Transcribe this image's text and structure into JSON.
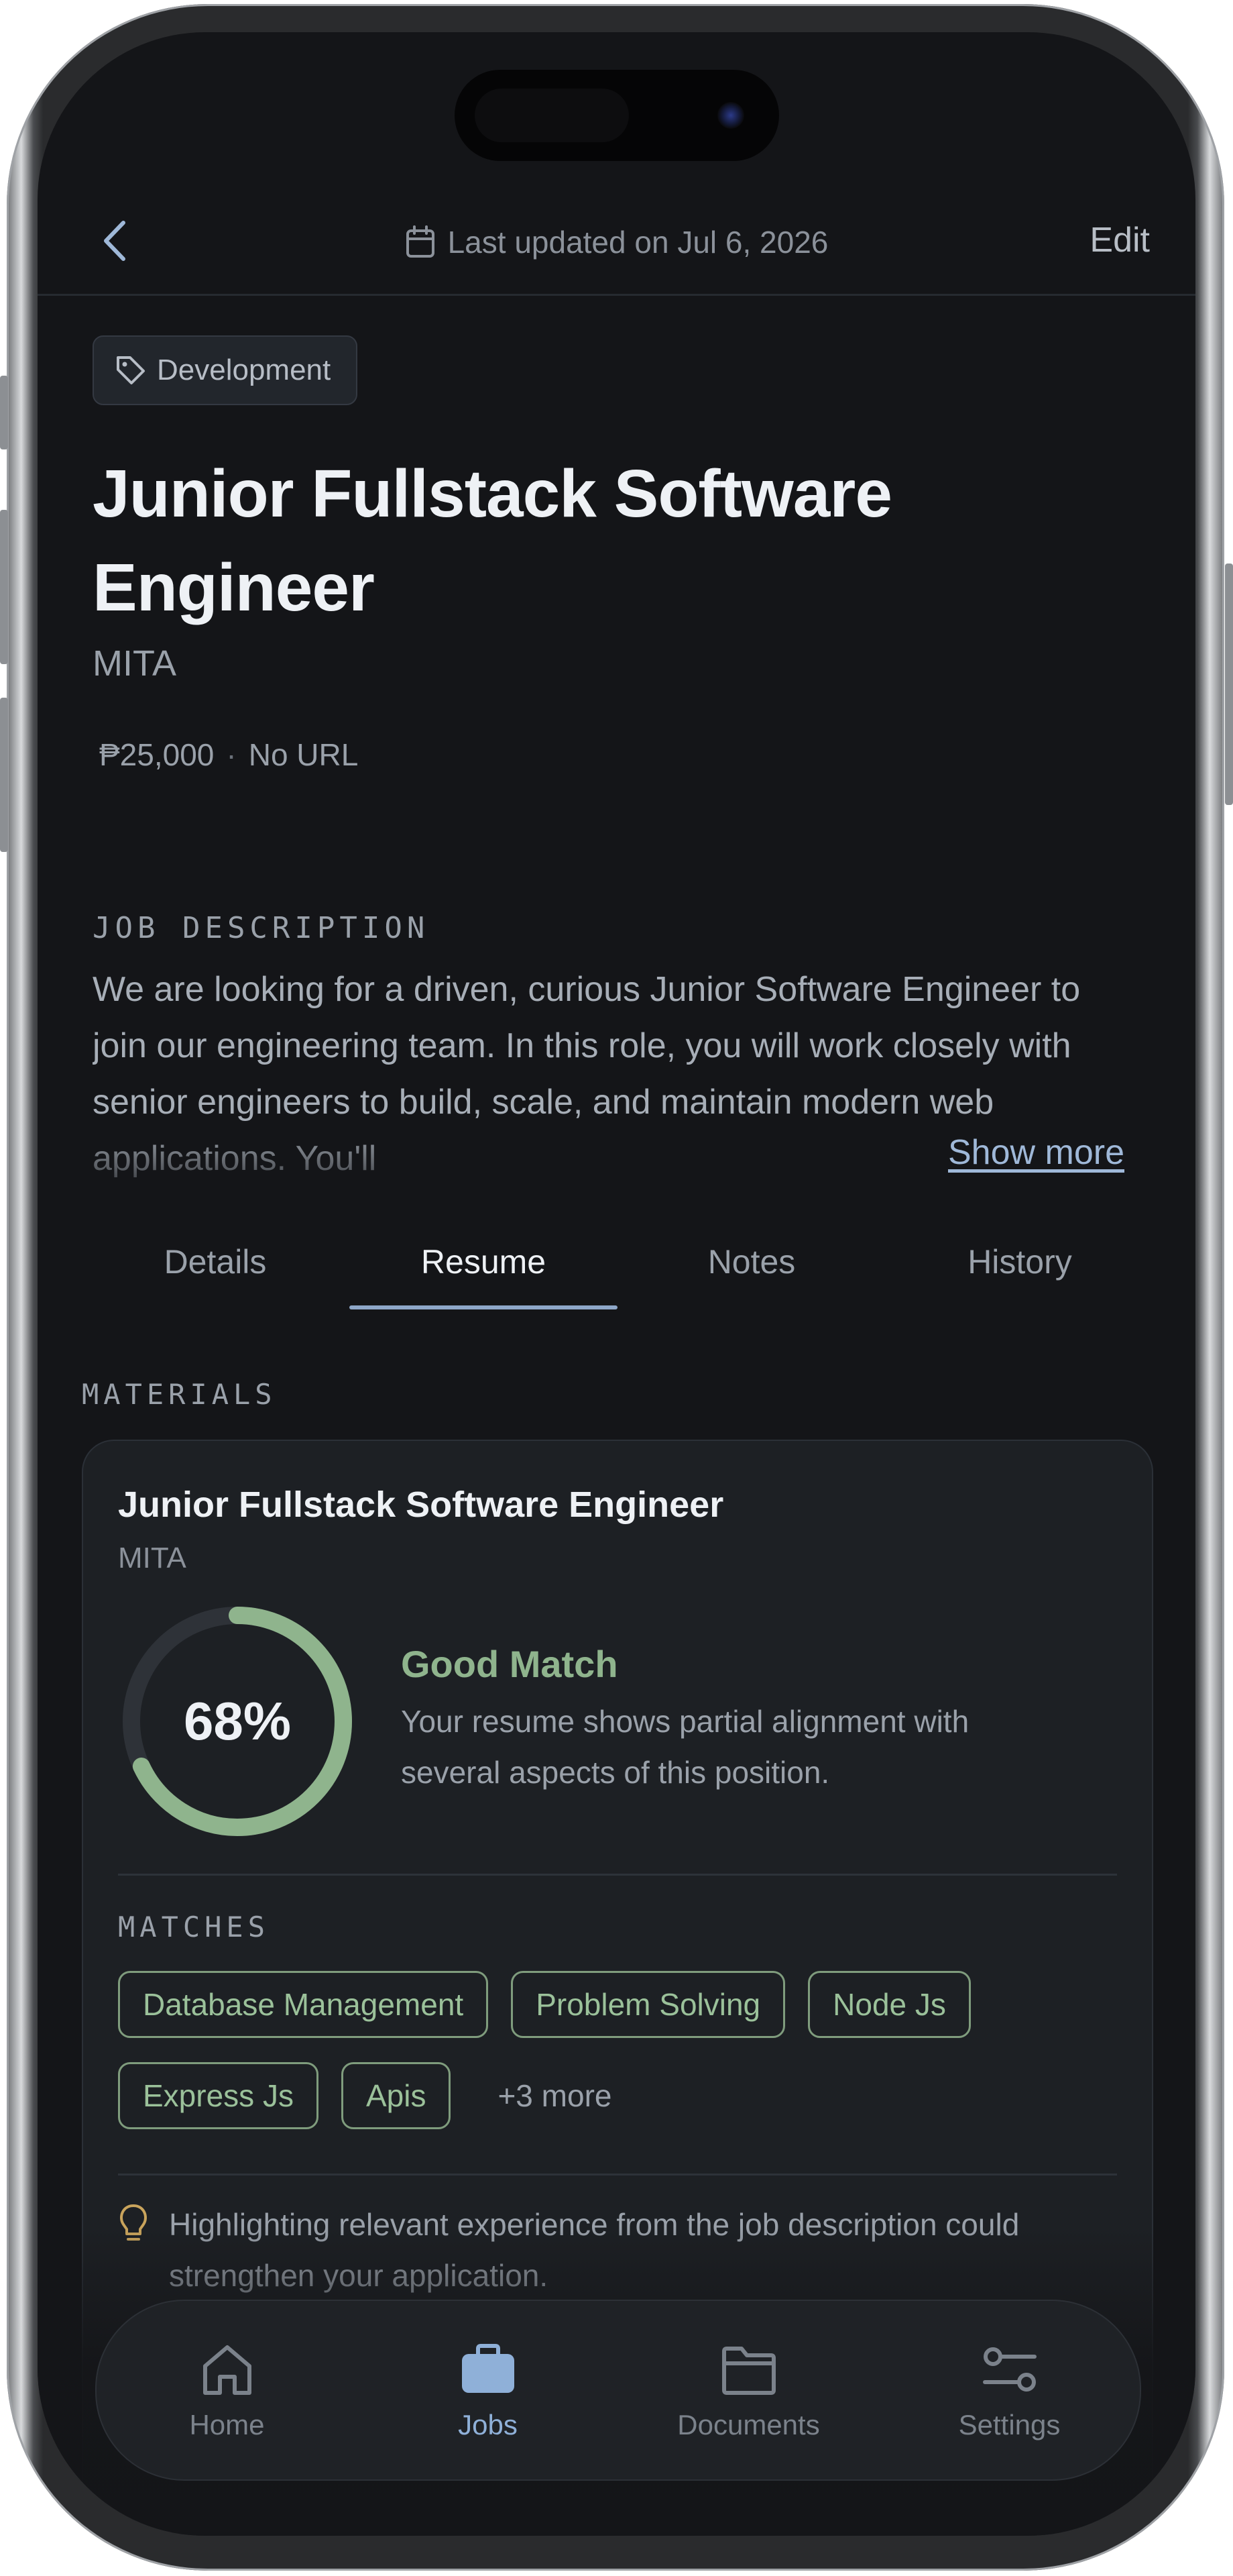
{
  "header": {
    "updated_text": "Last updated on Jul 6, 2026",
    "edit_label": "Edit"
  },
  "job": {
    "category": "Development",
    "title": "Junior Fullstack Software Engineer",
    "company": "MITA",
    "salary": "₱25,000",
    "url": "No URL"
  },
  "description": {
    "label": "JOB DESCRIPTION",
    "text": "We are looking for a driven, curious Junior Software Engineer to join our engineering team. In this role, you will work closely with senior engineers to build, scale, and maintain modern web applications. You'll",
    "show_more": "Show more"
  },
  "tabs": [
    {
      "label": "Details"
    },
    {
      "label": "Resume"
    },
    {
      "label": "Notes"
    },
    {
      "label": "History"
    }
  ],
  "active_tab": "Resume",
  "materials": {
    "label": "MATERIALS",
    "card": {
      "title": "Junior Fullstack Software Engineer",
      "company": "MITA",
      "score_value": 68,
      "score_text": "68%",
      "match_title": "Good Match",
      "match_desc": "Your resume shows partial alignment with several aspects of this position.",
      "matches_label": "MATCHES",
      "tags": [
        "Database Management",
        "Problem Solving",
        "Node Js",
        "Express Js",
        "Apis"
      ],
      "more": "+3 more",
      "tip": "Highlighting relevant experience from the job description could strengthen your application."
    }
  },
  "nav": {
    "items": [
      {
        "label": "Home",
        "icon": "home-icon"
      },
      {
        "label": "Jobs",
        "icon": "briefcase-icon"
      },
      {
        "label": "Documents",
        "icon": "folder-icon"
      },
      {
        "label": "Settings",
        "icon": "sliders-icon"
      }
    ],
    "active": "Jobs"
  },
  "colors": {
    "accent": "#8ea7c8",
    "match_green": "#8fb48d",
    "tip_amber": "#c9a45c",
    "background": "#141518"
  }
}
